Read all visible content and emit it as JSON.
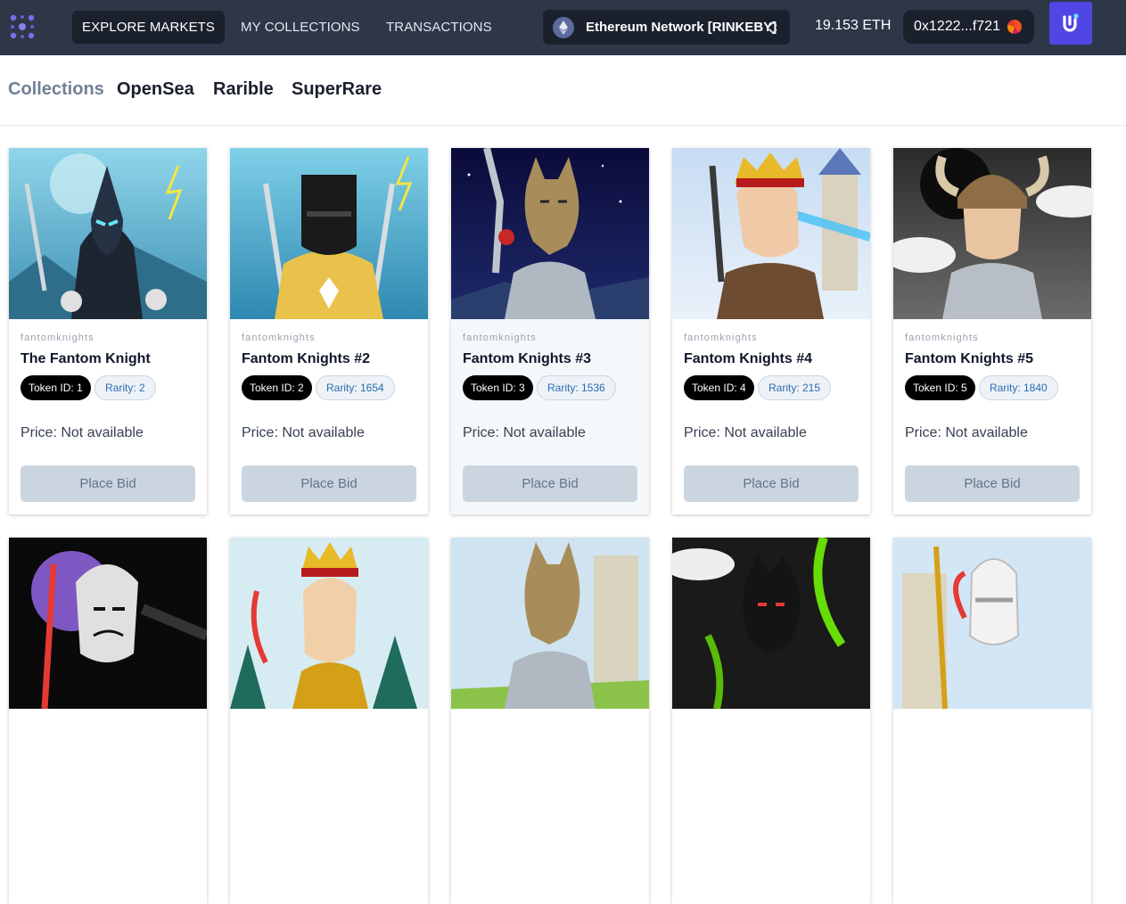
{
  "header": {
    "logo_icon": "dots-cluster-logo-icon",
    "nav": [
      {
        "label": "EXPLORE MARKETS",
        "active": true
      },
      {
        "label": "MY COLLECTIONS",
        "active": false
      },
      {
        "label": "TRANSACTIONS",
        "active": false
      }
    ],
    "network": {
      "icon": "ethereum-icon",
      "label": "Ethereum Network [RINKEBY]",
      "chevron_icon": "up-down-chevron-icon"
    },
    "balance": "19.153 ETH",
    "account": {
      "address": "0x1222...f721",
      "avatar_icon": "jazzicon-avatar"
    },
    "wallet_button_icon": "wallet-app-icon",
    "colors": {
      "bar": "#2d3748",
      "accent": "#5046e5"
    }
  },
  "tabs": [
    {
      "label": "Collections",
      "active": true
    },
    {
      "label": "OpenSea",
      "active": false
    },
    {
      "label": "Rarible",
      "active": false
    },
    {
      "label": "SuperRare",
      "active": false
    }
  ],
  "cards": [
    {
      "collection": "fantomknights",
      "name": "The Fantom Knight",
      "token": "Token ID: 1",
      "rarity": "Rarity: 2",
      "price": "Price: Not available",
      "bid_label": "Place Bid",
      "art": "dark-lich-knight"
    },
    {
      "collection": "fantomknights",
      "name": "Fantom Knights #2",
      "token": "Token ID: 2",
      "rarity": "Rarity: 1654",
      "price": "Price: Not available",
      "bid_label": "Place Bid",
      "art": "black-helm-golden-knight"
    },
    {
      "collection": "fantomknights",
      "name": "Fantom Knights #3",
      "token": "Token ID: 3",
      "rarity": "Rarity: 1536",
      "price": "Price: Not available",
      "bid_label": "Place Bid",
      "art": "wolf-knight-night"
    },
    {
      "collection": "fantomknights",
      "name": "Fantom Knights #4",
      "token": "Token ID: 4",
      "rarity": "Rarity: 215",
      "price": "Price: Not available",
      "bid_label": "Place Bid",
      "art": "crowned-laser-eyes"
    },
    {
      "collection": "fantomknights",
      "name": "Fantom Knights #5",
      "token": "Token ID: 5",
      "rarity": "Rarity: 1840",
      "price": "Price: Not available",
      "bid_label": "Place Bid",
      "art": "horned-viking-helm"
    },
    {
      "art": "masked-rogue-moon"
    },
    {
      "art": "crowned-golden-king"
    },
    {
      "art": "wolf-knight-castle"
    },
    {
      "art": "dark-dragon-green-flames"
    },
    {
      "art": "white-helm-paladin"
    }
  ]
}
